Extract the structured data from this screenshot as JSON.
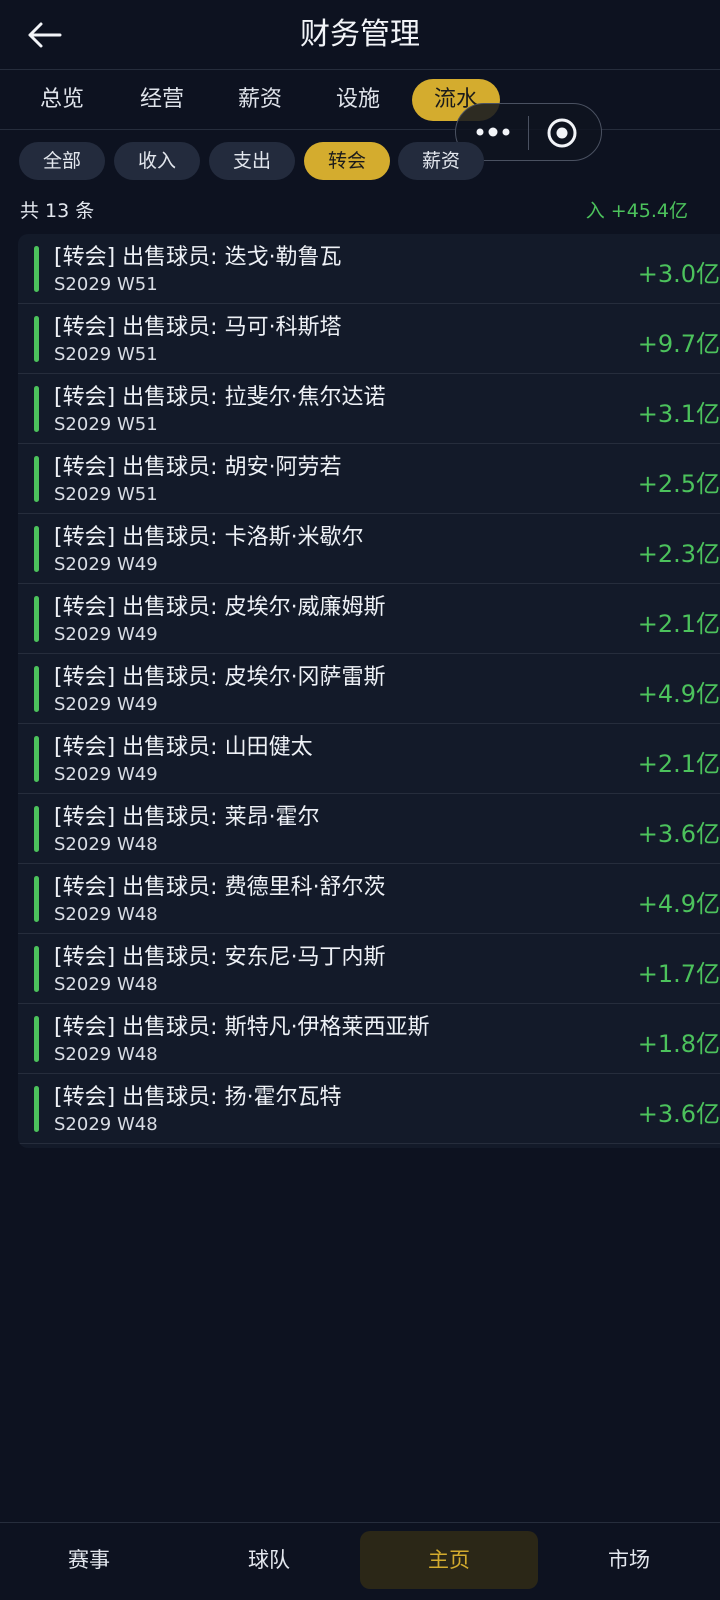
{
  "header": {
    "title": "财务管理"
  },
  "tabs": [
    {
      "label": "总览"
    },
    {
      "label": "经营"
    },
    {
      "label": "薪资"
    },
    {
      "label": "设施"
    },
    {
      "label": "流水",
      "active": true
    }
  ],
  "filters": [
    {
      "label": "全部"
    },
    {
      "label": "收入"
    },
    {
      "label": "支出"
    },
    {
      "label": "转会",
      "active": true
    },
    {
      "label": "薪资"
    }
  ],
  "summary": {
    "count": "共 13 条",
    "total": "入 +45.4亿"
  },
  "colors": {
    "accent": "#d4ac2e",
    "income": "#4cc25c",
    "background": "#0d1220"
  },
  "transactions": [
    {
      "title": "[转会] 出售球员: 迭戈·勒鲁瓦",
      "date": "S2029 W51",
      "amount": "+3.0亿"
    },
    {
      "title": "[转会] 出售球员: 马可·科斯塔",
      "date": "S2029 W51",
      "amount": "+9.7亿"
    },
    {
      "title": "[转会] 出售球员: 拉斐尔·焦尔达诺",
      "date": "S2029 W51",
      "amount": "+3.1亿"
    },
    {
      "title": "[转会] 出售球员: 胡安·阿劳若",
      "date": "S2029 W51",
      "amount": "+2.5亿"
    },
    {
      "title": "[转会] 出售球员: 卡洛斯·米歇尔",
      "date": "S2029 W49",
      "amount": "+2.3亿"
    },
    {
      "title": "[转会] 出售球员: 皮埃尔·威廉姆斯",
      "date": "S2029 W49",
      "amount": "+2.1亿"
    },
    {
      "title": "[转会] 出售球员: 皮埃尔·冈萨雷斯",
      "date": "S2029 W49",
      "amount": "+4.9亿"
    },
    {
      "title": "[转会] 出售球员: 山田健太",
      "date": "S2029 W49",
      "amount": "+2.1亿"
    },
    {
      "title": "[转会] 出售球员: 莱昂·霍尔",
      "date": "S2029 W48",
      "amount": "+3.6亿"
    },
    {
      "title": "[转会] 出售球员: 费德里科·舒尔茨",
      "date": "S2029 W48",
      "amount": "+4.9亿"
    },
    {
      "title": "[转会] 出售球员: 安东尼·马丁内斯",
      "date": "S2029 W48",
      "amount": "+1.7亿"
    },
    {
      "title": "[转会] 出售球员: 斯特凡·伊格莱西亚斯",
      "date": "S2029 W48",
      "amount": "+1.8亿"
    },
    {
      "title": "[转会] 出售球员: 扬·霍尔瓦特",
      "date": "S2029 W48",
      "amount": "+3.6亿"
    }
  ],
  "bottom_nav": [
    {
      "label": "赛事"
    },
    {
      "label": "球队"
    },
    {
      "label": "主页",
      "active": true
    },
    {
      "label": "市场"
    }
  ]
}
